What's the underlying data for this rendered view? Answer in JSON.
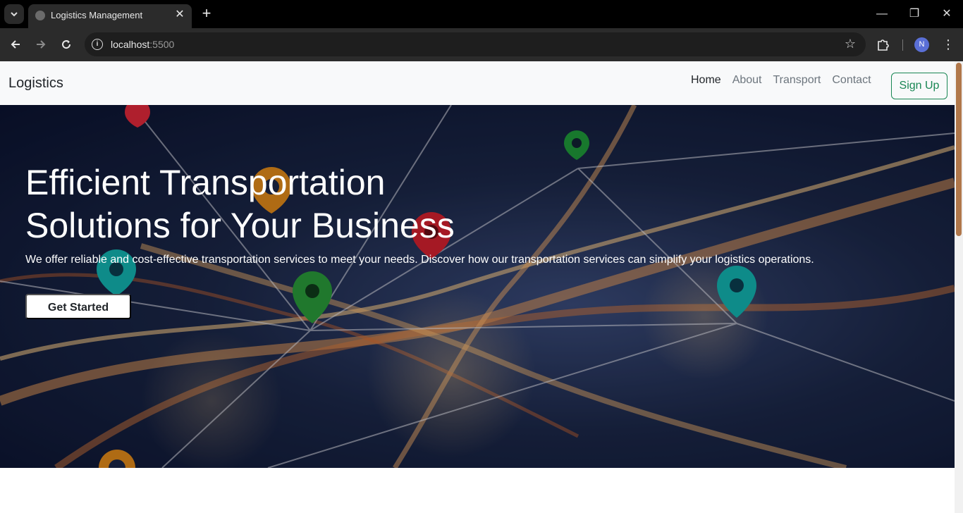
{
  "browser": {
    "tab_title": "Logistics Management",
    "url_host": "localhost",
    "url_port": ":5500",
    "profile_initial": "N"
  },
  "navbar": {
    "brand": "Logistics",
    "links": [
      {
        "label": "Home",
        "active": true
      },
      {
        "label": "About",
        "active": false
      },
      {
        "label": "Transport",
        "active": false
      },
      {
        "label": "Contact",
        "active": false
      }
    ],
    "signup_label": "Sign Up"
  },
  "hero": {
    "title_line1": "Efficient Transportation",
    "title_line2": "Solutions for Your Business",
    "subtitle": "We offer reliable and cost-effective transportation services to meet your needs. Discover how our transportation services can simplify your logistics operations.",
    "cta_label": "Get Started"
  },
  "colors": {
    "accent_green": "#198754",
    "navbar_bg": "#f8f9fa",
    "scroll_thumb": "#b0774a"
  }
}
